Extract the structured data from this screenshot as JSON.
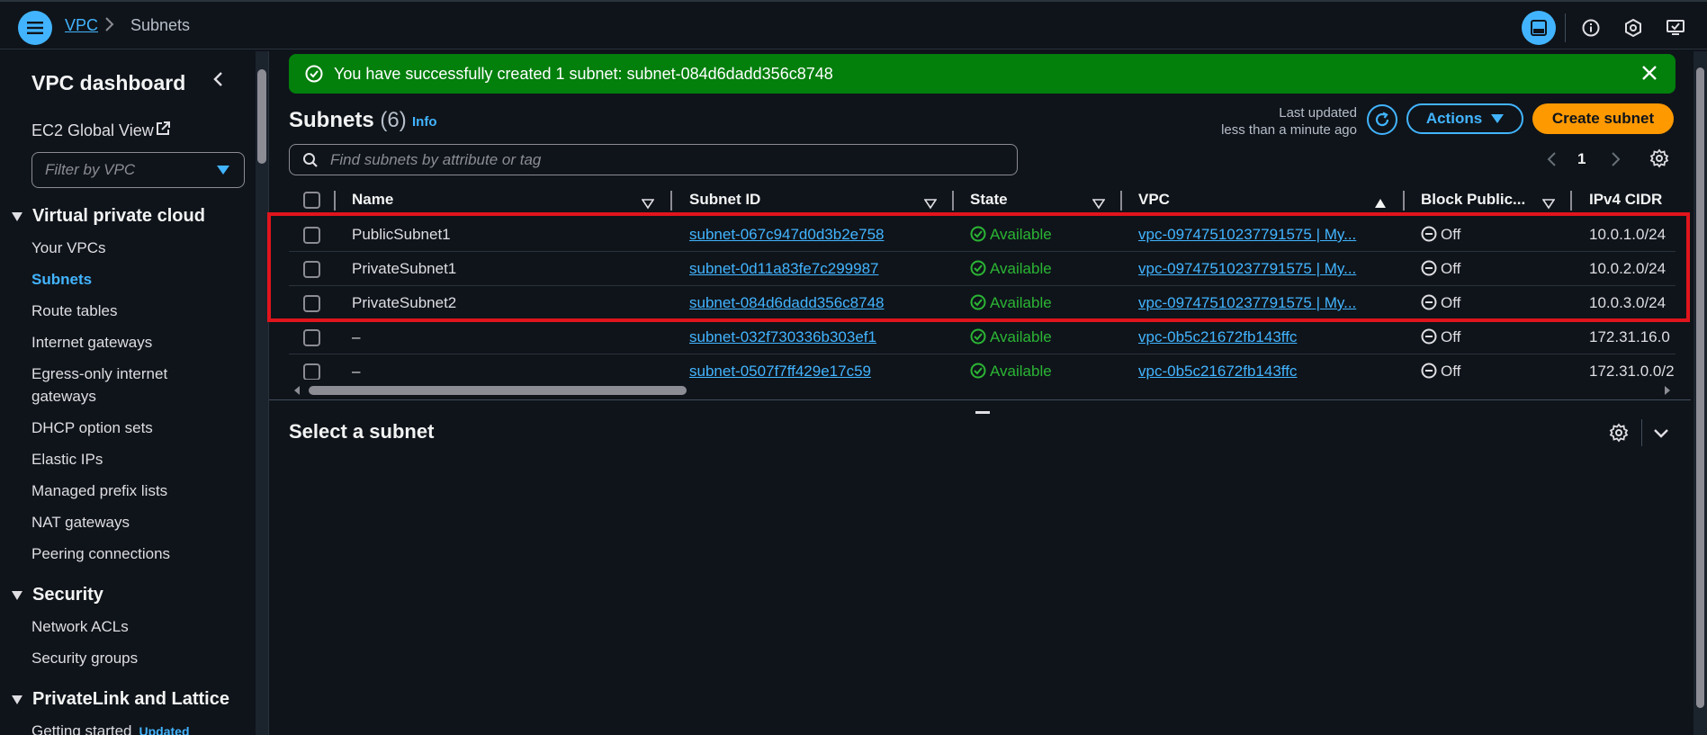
{
  "topbar": {
    "breadcrumb_root": "VPC",
    "breadcrumb_current": "Subnets",
    "icons": [
      "menu-icon",
      "split-panel-icon",
      "info-icon",
      "notifications-icon",
      "display-preferences-icon"
    ]
  },
  "sidebar": {
    "title": "VPC dashboard",
    "ec2_global_view": "EC2 Global View",
    "filter_placeholder": "Filter by VPC",
    "sections": [
      {
        "title": "Virtual private cloud",
        "items": [
          "Your VPCs",
          "Subnets",
          "Route tables",
          "Internet gateways",
          "Egress-only internet",
          "gateways",
          "DHCP option sets",
          "Elastic IPs",
          "Managed prefix lists",
          "NAT gateways",
          "Peering connections"
        ]
      },
      {
        "title": "Security",
        "items": [
          "Network ACLs",
          "Security groups"
        ]
      },
      {
        "title": "PrivateLink and Lattice",
        "items": [
          "Getting started"
        ],
        "badge": "Updated"
      }
    ],
    "active_item": "Subnets"
  },
  "flash": {
    "message": "You have successfully created 1 subnet: subnet-084d6dadd356c8748",
    "color": "#037f0c"
  },
  "header": {
    "title": "Subnets",
    "count": "(6)",
    "info": "Info",
    "last_updated_label": "Last updated",
    "last_updated_value": "less than a minute ago",
    "actions_label": "Actions",
    "create_label": "Create subnet"
  },
  "search": {
    "placeholder": "Find subnets by attribute or tag"
  },
  "pagination": {
    "page": "1"
  },
  "table": {
    "columns": [
      "Name",
      "Subnet ID",
      "State",
      "VPC",
      "Block Public...",
      "IPv4 CIDR"
    ],
    "rows": [
      {
        "name": "PublicSubnet1",
        "subnet_id": "subnet-067c947d0d3b2e758",
        "state": "Available",
        "vpc": "vpc-09747510237791575 | My...",
        "block": "Off",
        "cidr": "10.0.1.0/24"
      },
      {
        "name": "PrivateSubnet1",
        "subnet_id": "subnet-0d11a83fe7c299987",
        "state": "Available",
        "vpc": "vpc-09747510237791575 | My...",
        "block": "Off",
        "cidr": "10.0.2.0/24"
      },
      {
        "name": "PrivateSubnet2",
        "subnet_id": "subnet-084d6dadd356c8748",
        "state": "Available",
        "vpc": "vpc-09747510237791575 | My...",
        "block": "Off",
        "cidr": "10.0.3.0/24"
      },
      {
        "name": "–",
        "subnet_id": "subnet-032f730336b303ef1",
        "state": "Available",
        "vpc": "vpc-0b5c21672fb143ffc",
        "block": "Off",
        "cidr": "172.31.16.0"
      },
      {
        "name": "–",
        "subnet_id": "subnet-0507f7ff429e17c59",
        "state": "Available",
        "vpc": "vpc-0b5c21672fb143ffc",
        "block": "Off",
        "cidr": "172.31.0.0/2"
      }
    ],
    "highlighted_rows": 3,
    "highlight_color": "#e0141c"
  },
  "detail_panel": {
    "title": "Select a subnet"
  },
  "colors": {
    "accent": "#42b4ff",
    "primary_button": "#ff9900",
    "success": "#2bb534",
    "background": "#0f141a"
  }
}
